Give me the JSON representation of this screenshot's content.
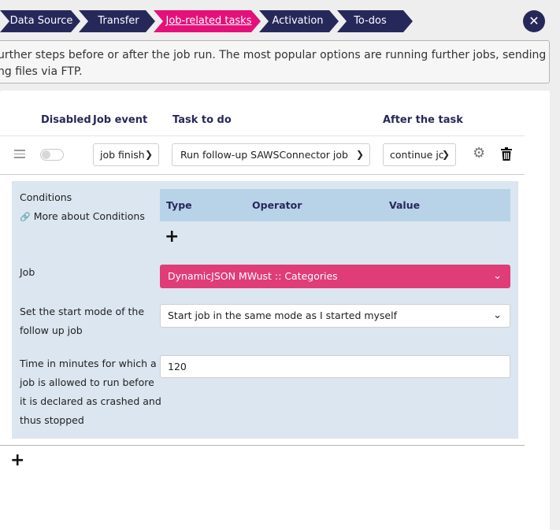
{
  "breadcrumb": [
    "Data Source",
    "Transfer",
    "Job-related tasks",
    "Activation",
    "To-dos"
  ],
  "close_label": "✕",
  "info": {
    "line1": "urther steps before or after the job run. The most popular options are running further jobs, sending a mail in",
    "line2": "ng files via FTP."
  },
  "table": {
    "headers": {
      "disabled": "Disabled",
      "job_event": "Job event",
      "task": "Task to do",
      "after": "After the task"
    },
    "row": {
      "job_event": "job finish",
      "task": "Run follow-up SAWSConnector job",
      "after": "continue jc"
    }
  },
  "conditions": {
    "title": "Conditions",
    "link": "More about Conditions",
    "columns": {
      "type": "Type",
      "operator": "Operator",
      "value": "Value"
    }
  },
  "job": {
    "label": "Job",
    "value": "DynamicJSON MWust :: Categories"
  },
  "start_mode": {
    "label_l1": "Set the start mode of the",
    "label_l2": "follow up job",
    "value": "Start job in the same mode as I started myself"
  },
  "timeout": {
    "label_l1": "Time in minutes for which a",
    "label_l2": "job is allowed to run before",
    "label_l3": "it is declared as crashed and",
    "label_l4": "thus stopped",
    "value": "120"
  },
  "colors": {
    "navy": "#27285a",
    "active": "#e4117a",
    "pink_field": "#e03c78",
    "cond_bg": "#dbe6f0"
  }
}
